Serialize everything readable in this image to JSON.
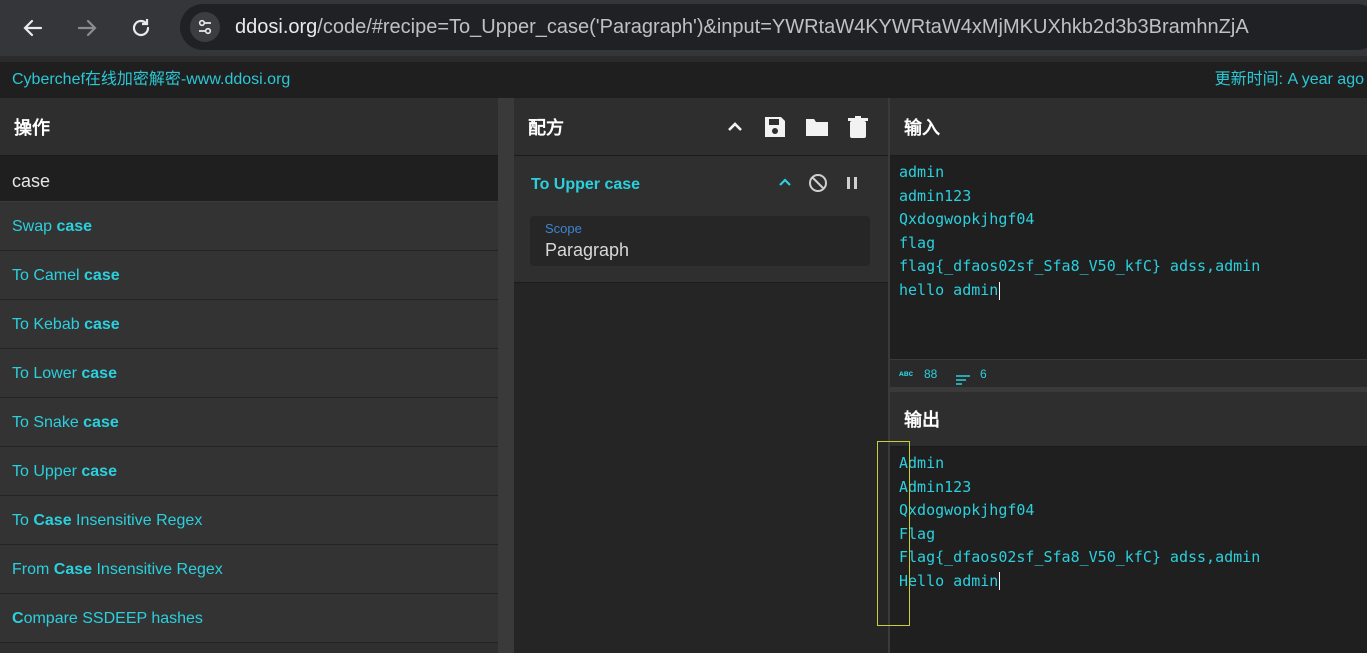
{
  "browser": {
    "back_icon": "arrow-left-icon",
    "forward_icon": "arrow-right-icon",
    "reload_icon": "reload-icon",
    "site_info_icon": "tune-icon",
    "url_host": "ddosi.org",
    "url_path": "/code/#recipe=To_Upper_case('Paragraph')&input=YWRtaW4KYWRtaW4xMjMKUXhkb2d3b3BramhnZjA"
  },
  "banner": {
    "left": "Cyberchef在线加密解密-www.ddosi.org",
    "right": "更新时间: A year ago"
  },
  "operations": {
    "title": "操作",
    "search_value": "case",
    "items": [
      {
        "pre": "Swap ",
        "bold": "case",
        "post": ""
      },
      {
        "pre": "To Camel ",
        "bold": "case",
        "post": ""
      },
      {
        "pre": "To Kebab ",
        "bold": "case",
        "post": ""
      },
      {
        "pre": "To Lower ",
        "bold": "case",
        "post": ""
      },
      {
        "pre": "To Snake ",
        "bold": "case",
        "post": ""
      },
      {
        "pre": "To Upper ",
        "bold": "case",
        "post": ""
      },
      {
        "pre": "To ",
        "bold": "Case",
        "post": " Insensitive Regex"
      },
      {
        "pre": "From ",
        "bold": "Case",
        "post": " Insensitive Regex"
      },
      {
        "pre": "",
        "bold": "C",
        "post": "ompare SSDEEP hashes"
      }
    ]
  },
  "recipe": {
    "title": "配方",
    "op_title": "To Upper case",
    "scope_label": "Scope",
    "scope_value": "Paragraph"
  },
  "input": {
    "title": "输入",
    "text": "admin\nadmin123\nQxdogwopkjhgf04\nflag\nflag{_dfaos02sf_Sfa8_V50_kfC} adss,admin\nhello admin",
    "char_count": "88",
    "line_count": "6"
  },
  "output": {
    "title": "输出",
    "text": "Admin\nAdmin123\nQxdogwopkjhgf04\nFlag\nFlag{_dfaos02sf_Sfa8_V50_kfC} adss,admin\nHello admin"
  },
  "colors": {
    "accent": "#2bd0de",
    "scope_label": "#3b86d6",
    "highlight_box": "#c9cf3a"
  }
}
